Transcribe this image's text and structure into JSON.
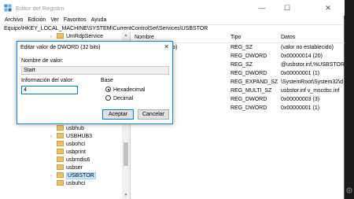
{
  "window": {
    "title": "Editor del Registro",
    "minimize": "—",
    "maximize": "☐",
    "close": "✕"
  },
  "menu": [
    "Archivo",
    "Edición",
    "Ver",
    "Favoritos",
    "Ayuda"
  ],
  "address": "Equipo\\HKEY_LOCAL_MACHINE\\SYSTEM\\CurrentControlSet\\Services\\USBSTOR",
  "tree": {
    "items": [
      {
        "label": "UmRdpService",
        "arrow": "›"
      },
      {
        "label": "usbhub",
        "arrow": ""
      },
      {
        "label": "USBHUB3",
        "arrow": "›"
      },
      {
        "label": "usbohci",
        "arrow": ""
      },
      {
        "label": "usbprint",
        "arrow": ""
      },
      {
        "label": "usbrndis6",
        "arrow": ""
      },
      {
        "label": "usbser",
        "arrow": ""
      },
      {
        "label": "USBSTOR",
        "arrow": "›"
      },
      {
        "label": "usbuhci",
        "arrow": ""
      }
    ]
  },
  "list": {
    "headers": {
      "name": "Nombre",
      "type": "Tipo",
      "data": "Datos"
    },
    "rows": [
      {
        "name": "(Predeterminado)",
        "type": "REG_SZ",
        "data": "(valor no establecido)"
      },
      {
        "name": "",
        "type": "REG_DWORD",
        "data": "0x00000014 (20)"
      },
      {
        "name": "",
        "type": "REG_SZ",
        "data": "@usbstor.inf,%USBSTOR.Sv"
      },
      {
        "name": "",
        "type": "REG_DWORD",
        "data": "0x00000001 (1)"
      },
      {
        "name": "",
        "type": "REG_EXPAND_SZ",
        "data": "\\SystemRoot\\System32\\d"
      },
      {
        "name": "",
        "type": "REG_MULTI_SZ",
        "data": "usbstor.inf v_mscdsc.inf"
      },
      {
        "name": "",
        "type": "REG_DWORD",
        "data": "0x00000003 (3)"
      },
      {
        "name": "",
        "type": "REG_DWORD",
        "data": "0x00000001 (1)"
      }
    ]
  },
  "dialog": {
    "title": "Editar valor de DWORD (32 bits)",
    "close": "✕",
    "name_label": "Nombre de valor:",
    "name_value": "Start",
    "info_label": "Información del valor:",
    "info_value": "4",
    "base_label": "Base",
    "hex_label": "Hexadecimal",
    "dec_label": "Decimal",
    "base_selected": "hex",
    "ok_label": "Aceptar",
    "cancel_label": "Cancelar"
  },
  "icons": {
    "app": "registry-editor-icon",
    "folder": "folder-icon",
    "watermark": "watermark-icon"
  },
  "colors": {
    "accent": "#0078d7",
    "selection": "#cce8ff",
    "folder": "#e8c36a"
  }
}
